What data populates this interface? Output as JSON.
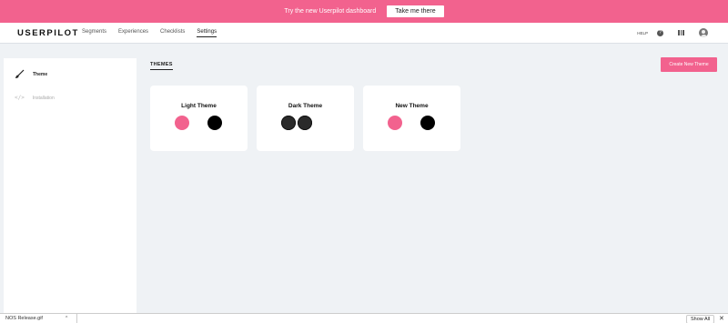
{
  "banner": {
    "text": "Try the new Userpilot dashboard",
    "button": "Take me there"
  },
  "nav": {
    "logo": "USERPILOT",
    "links": [
      "Segments",
      "Experiences",
      "Checklists",
      "Settings"
    ],
    "help": "HELP"
  },
  "sidebar": {
    "items": [
      {
        "label": "Theme",
        "icon": "brush-icon"
      },
      {
        "label": "Installation",
        "icon": "code-icon"
      }
    ]
  },
  "main": {
    "section_label": "THEMES",
    "create_button": "Create New Theme",
    "themes": [
      {
        "name": "Light Theme",
        "swatches": [
          "#f2628e",
          "#ffffff",
          "#000000"
        ]
      },
      {
        "name": "Dark Theme",
        "swatches": [
          "#2a2a2a",
          "#2a2a2a",
          "#ffffff"
        ]
      },
      {
        "name": "New Theme",
        "swatches": [
          "#f2628e",
          "#ffffff",
          "#000000"
        ]
      }
    ]
  },
  "download_bar": {
    "file": "NOS Release.gif",
    "show_all": "Show All"
  },
  "colors": {
    "accent": "#f2628e",
    "background": "#eff2f5"
  }
}
